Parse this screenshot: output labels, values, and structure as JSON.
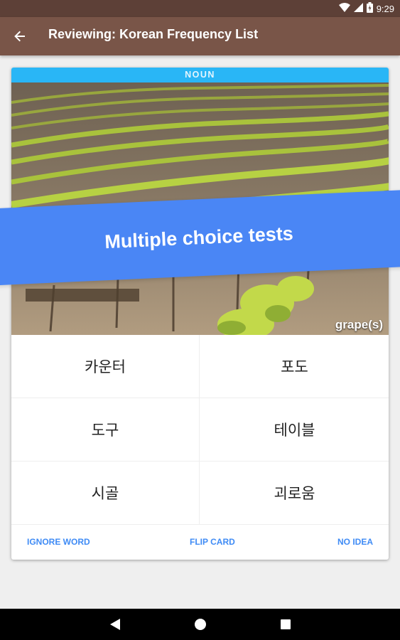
{
  "status_bar": {
    "time": "9:29",
    "icons": [
      "wifi-icon",
      "signal-icon",
      "battery-icon"
    ]
  },
  "toolbar": {
    "back_icon": "arrow-back-icon",
    "title": "Reviewing: Korean Frequency List",
    "background": "#795548"
  },
  "card": {
    "part_of_speech": "NOUN",
    "image_caption": "grape(s)",
    "options": [
      {
        "label": "카운터"
      },
      {
        "label": "포도"
      },
      {
        "label": "도구"
      },
      {
        "label": "테이블"
      },
      {
        "label": "시골"
      },
      {
        "label": "괴로움"
      }
    ],
    "actions": {
      "ignore_label": "IGNORE WORD",
      "flip_label": "FLIP CARD",
      "no_idea_label": "NO IDEA"
    }
  },
  "banner": {
    "text": "Multiple choice tests",
    "color": "#4a86f5"
  },
  "nav_bar": {
    "icons": [
      "back-triangle-icon",
      "home-circle-icon",
      "recents-square-icon"
    ]
  }
}
